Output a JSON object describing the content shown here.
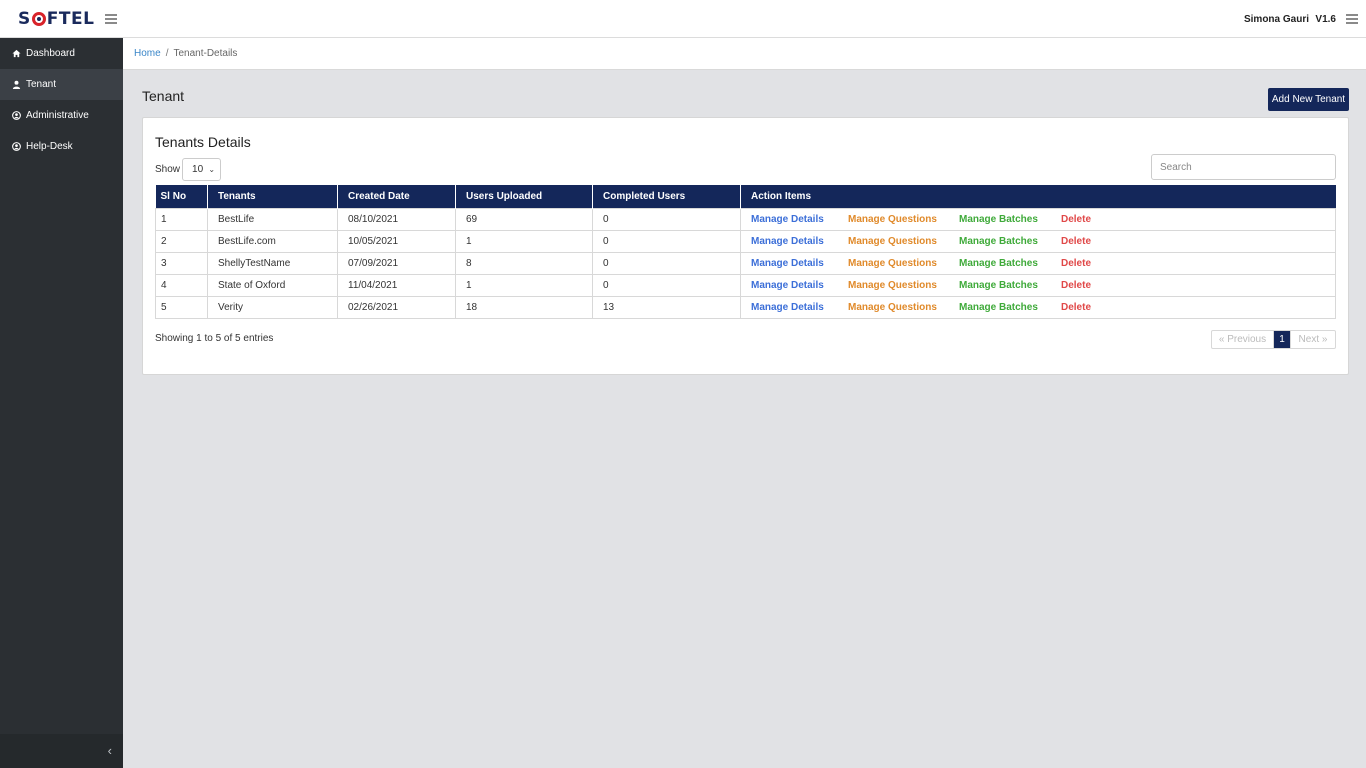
{
  "header": {
    "logo_left": "S",
    "logo_right": "FTEL",
    "user_name": "Simona Gauri",
    "version": "V1.6"
  },
  "sidebar": {
    "items": [
      {
        "label": "Dashboard",
        "icon": "home-icon"
      },
      {
        "label": "Tenant",
        "icon": "user-icon",
        "active": true
      },
      {
        "label": "Administrative",
        "icon": "user-circle-icon"
      },
      {
        "label": "Help-Desk",
        "icon": "user-circle-icon"
      }
    ]
  },
  "breadcrumb": {
    "home": "Home",
    "separator": "/",
    "current": "Tenant-Details"
  },
  "page": {
    "title": "Tenant",
    "add_button": "Add New Tenant"
  },
  "card": {
    "title": "Tenants Details",
    "show_label": "Show",
    "show_value": "10",
    "search_placeholder": "Search",
    "columns": [
      "Sl No",
      "Tenants",
      "Created Date",
      "Users Uploaded",
      "Completed Users",
      "Action Items"
    ],
    "rows": [
      {
        "sl": "1",
        "tenant": "BestLife",
        "created": "08/10/2021",
        "uploaded": "69",
        "completed": "0"
      },
      {
        "sl": "2",
        "tenant": "BestLife.com",
        "created": "10/05/2021",
        "uploaded": "1",
        "completed": "0"
      },
      {
        "sl": "3",
        "tenant": "ShellyTestName",
        "created": "07/09/2021",
        "uploaded": "8",
        "completed": "0"
      },
      {
        "sl": "4",
        "tenant": "State of Oxford",
        "created": "11/04/2021",
        "uploaded": "1",
        "completed": "0"
      },
      {
        "sl": "5",
        "tenant": "Verity",
        "created": "02/26/2021",
        "uploaded": "18",
        "completed": "13"
      }
    ],
    "actions": {
      "details": "Manage Details",
      "questions": "Manage Questions",
      "batches": "Manage Batches",
      "delete": "Delete"
    },
    "info": "Showing 1 to 5 of 5 entries",
    "pager": {
      "prev": "« Previous",
      "page": "1",
      "next": "Next »"
    }
  },
  "colors": {
    "primary": "#14275a",
    "sidebar": "#2b2f33",
    "details": "#3c6fd8",
    "questions": "#e08a2b",
    "batches": "#3faa3a",
    "delete": "#e04848"
  }
}
